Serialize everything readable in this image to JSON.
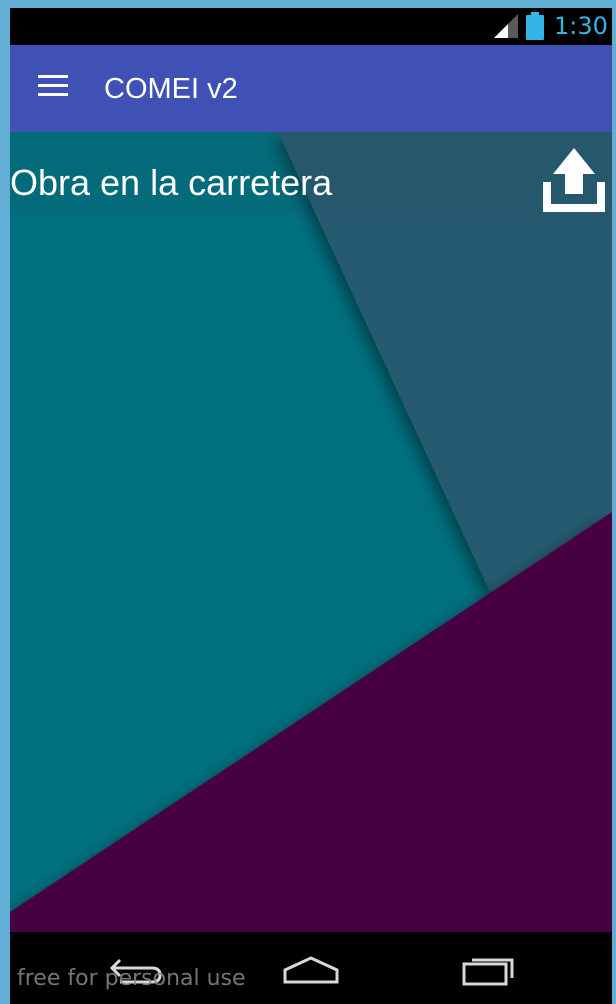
{
  "status_bar": {
    "time": "1:30",
    "icons": [
      "signal-icon",
      "battery-icon"
    ]
  },
  "app_bar": {
    "menu_icon": "hamburger-menu-icon",
    "title": "COMEI v2",
    "color": "#3f51b5"
  },
  "content": {
    "section_title": "Obra en la carretera",
    "action_icon": "upload-icon",
    "colors": {
      "teal": "#00707f",
      "slate": "#275a6f",
      "purple": "#470642"
    }
  },
  "nav_bar": {
    "buttons": [
      "back-icon",
      "home-icon",
      "recent-apps-icon"
    ]
  },
  "watermark": "free for personal use"
}
